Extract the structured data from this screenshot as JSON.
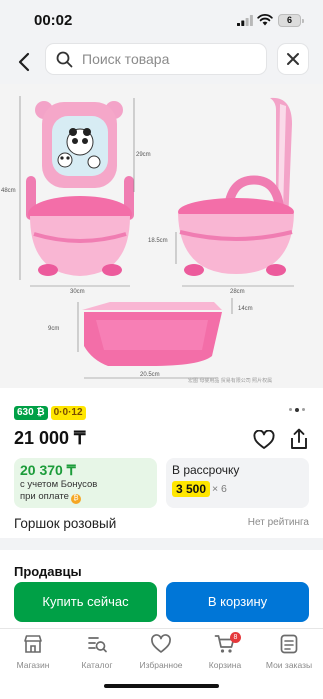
{
  "status_bar": {
    "time": "00:02",
    "battery": "6"
  },
  "top_bar": {
    "search_placeholder": "Поиск товара"
  },
  "product_image": {
    "dim_height_total": "48cm",
    "dim_height_back": "29cm",
    "dim_depth": "18.5cm",
    "dim_width_front": "30cm",
    "dim_width_side": "28cm",
    "dim_bowl_height": "9cm",
    "dim_bowl_rim": "14cm",
    "dim_bowl_length": "20.5cm",
    "watermark": "宏图 母婴用品 贸易有限公司 照片权属"
  },
  "price": {
    "badge_bonus": "630 ₿",
    "badge_installment": "0·0·12",
    "main": "21 000 ₸",
    "bonus_price": "20 370 ₸",
    "bonus_note_line1": "с учетом Бонусов",
    "bonus_note_line2": "при оплате",
    "installment_title": "В рассрочку",
    "installment_amount": "3 500",
    "installment_times": "× 6"
  },
  "product": {
    "name": "Горшок розовый",
    "rating": "Нет рейтинга"
  },
  "sellers": {
    "title": "Продавцы"
  },
  "actions": {
    "buy_now": "Купить сейчас",
    "add_to_cart": "В корзину"
  },
  "bottom_nav": {
    "items": [
      {
        "label": "Магазин",
        "icon": "shop-icon"
      },
      {
        "label": "Каталог",
        "icon": "catalog-icon"
      },
      {
        "label": "Избранное",
        "icon": "heart-icon"
      },
      {
        "label": "Корзина",
        "icon": "cart-icon",
        "badge": "8"
      },
      {
        "label": "Мои заказы",
        "icon": "orders-icon"
      }
    ]
  },
  "colors": {
    "accent_green": "#00a046",
    "accent_blue": "#0076d7",
    "bonus_yellow": "#ffe600",
    "product_pink": "#f06aa6"
  }
}
